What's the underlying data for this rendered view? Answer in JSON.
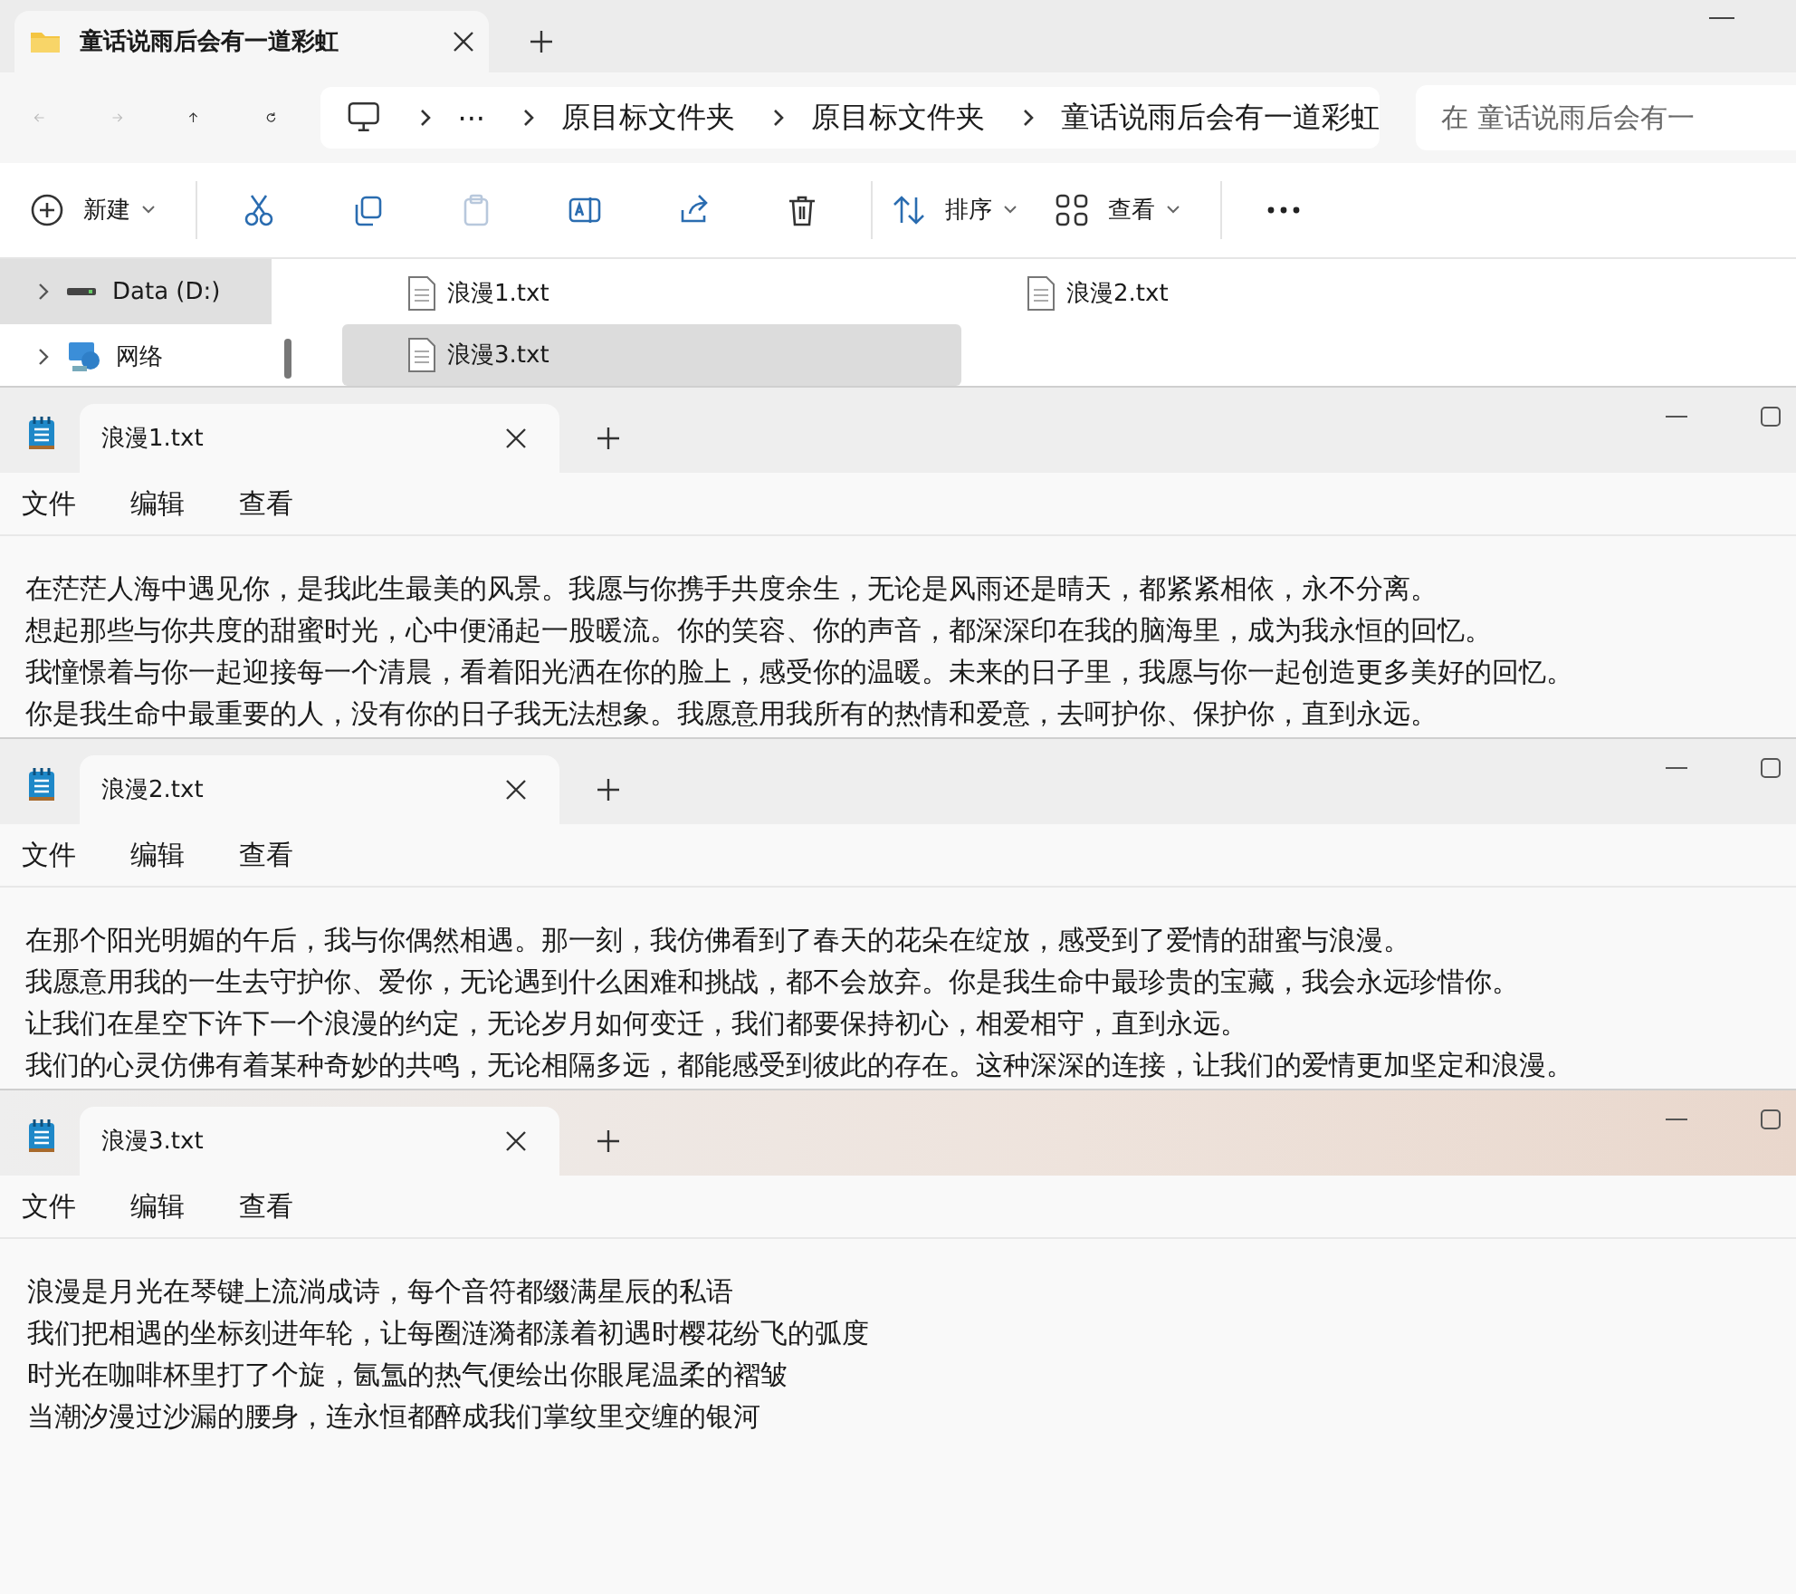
{
  "explorer": {
    "tab": {
      "title": "童话说雨后会有一道彩虹"
    },
    "nav": [
      {
        "kind": "back",
        "disabled": true
      },
      {
        "kind": "forward",
        "disabled": true
      },
      {
        "kind": "up",
        "disabled": false
      },
      {
        "kind": "refresh",
        "disabled": false
      }
    ],
    "breadcrumbs": [
      "···",
      "原目标文件夹",
      "原目标文件夹",
      "童话说雨后会有一道彩虹"
    ],
    "search": {
      "placeholder": "在 童话说雨后会有一"
    },
    "toolbar": [
      {
        "kind": "new",
        "label": "新建"
      },
      {
        "kind": "cut"
      },
      {
        "kind": "copy"
      },
      {
        "kind": "paste",
        "disabled": true
      },
      {
        "kind": "rename"
      },
      {
        "kind": "share"
      },
      {
        "kind": "delete"
      },
      {
        "kind": "sort",
        "label": "排序"
      },
      {
        "kind": "view",
        "label": "查看"
      },
      {
        "kind": "more"
      }
    ],
    "sidebar": {
      "items": [
        {
          "kind": "drive",
          "label": "Data (D:)",
          "selected": true
        },
        {
          "kind": "network",
          "label": "网络",
          "selected": false
        }
      ]
    },
    "files": [
      {
        "name": "浪漫1.txt",
        "selected": false
      },
      {
        "name": "浪漫2.txt",
        "selected": false
      },
      {
        "name": "浪漫3.txt",
        "selected": true
      }
    ]
  },
  "notepads": [
    {
      "tab": "浪漫1.txt",
      "focused": false,
      "menu": [
        "文件",
        "编辑",
        "查看"
      ],
      "lines": [
        "在茫茫人海中遇见你，是我此生最美的风景。我愿与你携手共度余生，无论是风雨还是晴天，都紧紧相依，永不分离。",
        "想起那些与你共度的甜蜜时光，心中便涌起一股暖流。你的笑容、你的声音，都深深印在我的脑海里，成为我永恒的回忆。",
        "我憧憬着与你一起迎接每一个清晨，看着阳光洒在你的脸上，感受你的温暖。未来的日子里，我愿与你一起创造更多美好的回忆。",
        "你是我生命中最重要的人，没有你的日子我无法想象。我愿意用我所有的热情和爱意，去呵护你、保护你，直到永远。"
      ]
    },
    {
      "tab": "浪漫2.txt",
      "focused": false,
      "menu": [
        "文件",
        "编辑",
        "查看"
      ],
      "lines": [
        "在那个阳光明媚的午后，我与你偶然相遇。那一刻，我仿佛看到了春天的花朵在绽放，感受到了爱情的甜蜜与浪漫。",
        "我愿意用我的一生去守护你、爱你，无论遇到什么困难和挑战，都不会放弃。你是我生命中最珍贵的宝藏，我会永远珍惜你。",
        "让我们在星空下许下一个浪漫的约定，无论岁月如何变迁，我们都要保持初心，相爱相守，直到永远。",
        "我们的心灵仿佛有着某种奇妙的共鸣，无论相隔多远，都能感受到彼此的存在。这种深深的连接，让我们的爱情更加坚定和浪漫。"
      ]
    },
    {
      "tab": "浪漫3.txt",
      "focused": true,
      "menu": [
        "文件",
        "编辑",
        "查看"
      ],
      "lines": [
        "浪漫是月光在琴键上流淌成诗，每个音符都缀满星辰的私语",
        "我们把相遇的坐标刻进年轮，让每圈涟漪都漾着初遇时樱花纷飞的弧度",
        "时光在咖啡杯里打了个旋，氤氲的热气便绘出你眼尾温柔的褶皱",
        "当潮汐漫过沙漏的腰身，连永恒都醉成我们掌纹里交缠的银河"
      ]
    }
  ]
}
